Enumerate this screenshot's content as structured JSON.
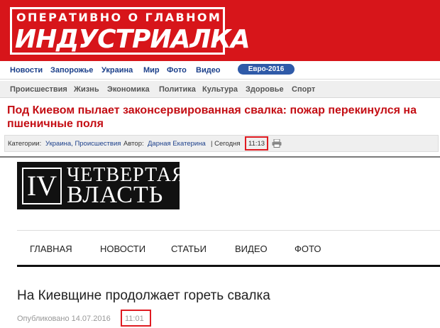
{
  "industrialka": {
    "logo": {
      "tagline": "ОПЕРАТИВНО О ГЛАВНОМ",
      "name": "ИНДУСТРИАЛКА"
    },
    "nav_primary": [
      "Новости",
      "Запорожье",
      "Украина",
      "Мир",
      "Фото",
      "Видео"
    ],
    "euro_button": "Евро-2016",
    "nav_secondary": [
      "Происшествия",
      "Жизнь",
      "Экономика",
      "Политика",
      "Культура",
      "Здоровье",
      "Спорт"
    ],
    "headline": "Под Киевом пылает законсервированная свалка: пожар перекинулся на пшеничные поля",
    "meta": {
      "categories_label": "Категории:",
      "categories": "Украина, Происшествия",
      "author_label": "Автор:",
      "author": "Дарная Екатерина",
      "date_prefix": "| Сегодня",
      "time": "11:13"
    },
    "icons": {
      "print": "printer-icon"
    },
    "colors": {
      "brand_red": "#d7151a",
      "nav_blue": "#1b3f8a",
      "highlight": "#e01b22"
    }
  },
  "chetvertaya_vlast": {
    "logo": {
      "numeral": "IV",
      "word1": "ЧЕТВЕРТАЯ",
      "word2": "ВЛАСТЬ"
    },
    "nav": [
      "ГЛАВНАЯ",
      "НОВОСТИ",
      "СТАТЬИ",
      "ВИДЕО",
      "ФОТО"
    ],
    "headline": "На Киевщине продолжает гореть свалка",
    "meta": {
      "published": "Опубликовано 14.07.2016",
      "time": "11:01"
    }
  }
}
